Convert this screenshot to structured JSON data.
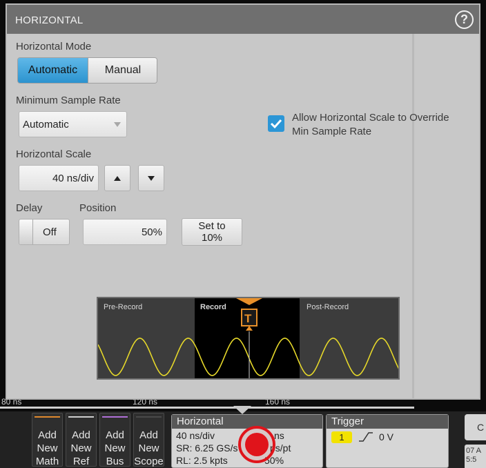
{
  "panel": {
    "title": "HORIZONTAL",
    "help_icon": "help-circle-icon"
  },
  "horizontal_mode": {
    "label": "Horizontal Mode",
    "options": [
      "Automatic",
      "Manual"
    ],
    "selected": "Automatic"
  },
  "min_sample_rate": {
    "label": "Minimum Sample Rate",
    "value": "Automatic"
  },
  "override_checkbox": {
    "label_line1": "Allow Horizontal Scale to Override",
    "label_line2": "Min Sample Rate",
    "checked": true
  },
  "horizontal_scale": {
    "label": "Horizontal Scale",
    "value": "40 ns/div"
  },
  "delay": {
    "label": "Delay",
    "toggle_value": "Off"
  },
  "position": {
    "label": "Position",
    "value": "50%",
    "set_to_line1": "Set to",
    "set_to_line2": "10%"
  },
  "record_diagram": {
    "pre_label": "Pre-Record",
    "record_label": "Record",
    "post_label": "Post-Record",
    "trigger_marker": "T"
  },
  "time_axis": {
    "ticks": [
      "80 ns",
      "120 ns",
      "160 ns"
    ]
  },
  "bottom_bar": {
    "add_buttons": [
      {
        "line1": "Add",
        "line2": "New",
        "line3": "Math",
        "color": "#e08a2e"
      },
      {
        "line1": "Add",
        "line2": "New",
        "line3": "Ref",
        "color": "#cfcfcf"
      },
      {
        "line1": "Add",
        "line2": "New",
        "line3": "Bus",
        "color": "#b070d8"
      },
      {
        "line1": "Add",
        "line2": "New",
        "line3": "Scope",
        "color": "#4a4a4a"
      }
    ],
    "horizontal_badge": {
      "title": "Horizontal",
      "line1_left": "40 ns/div",
      "line1_right": "ns",
      "line2_left": "SR: 6.25 GS/s",
      "line2_right": "ps/pt",
      "line3_left": "RL: 2.5 kpts",
      "line3_right": "50%"
    },
    "trigger_badge": {
      "title": "Trigger",
      "channel": "1",
      "level": "0 V",
      "channel_color": "#f2e200"
    },
    "right_edge": {
      "button_glyph": "C",
      "date_line1": "07 A",
      "date_line2": "5:5"
    }
  },
  "colors": {
    "selected_blue": "#2c93cf",
    "waveform_yellow": "#e6d82a",
    "trigger_orange": "#e8902a",
    "touch_indicator_red": "#e0141b"
  }
}
